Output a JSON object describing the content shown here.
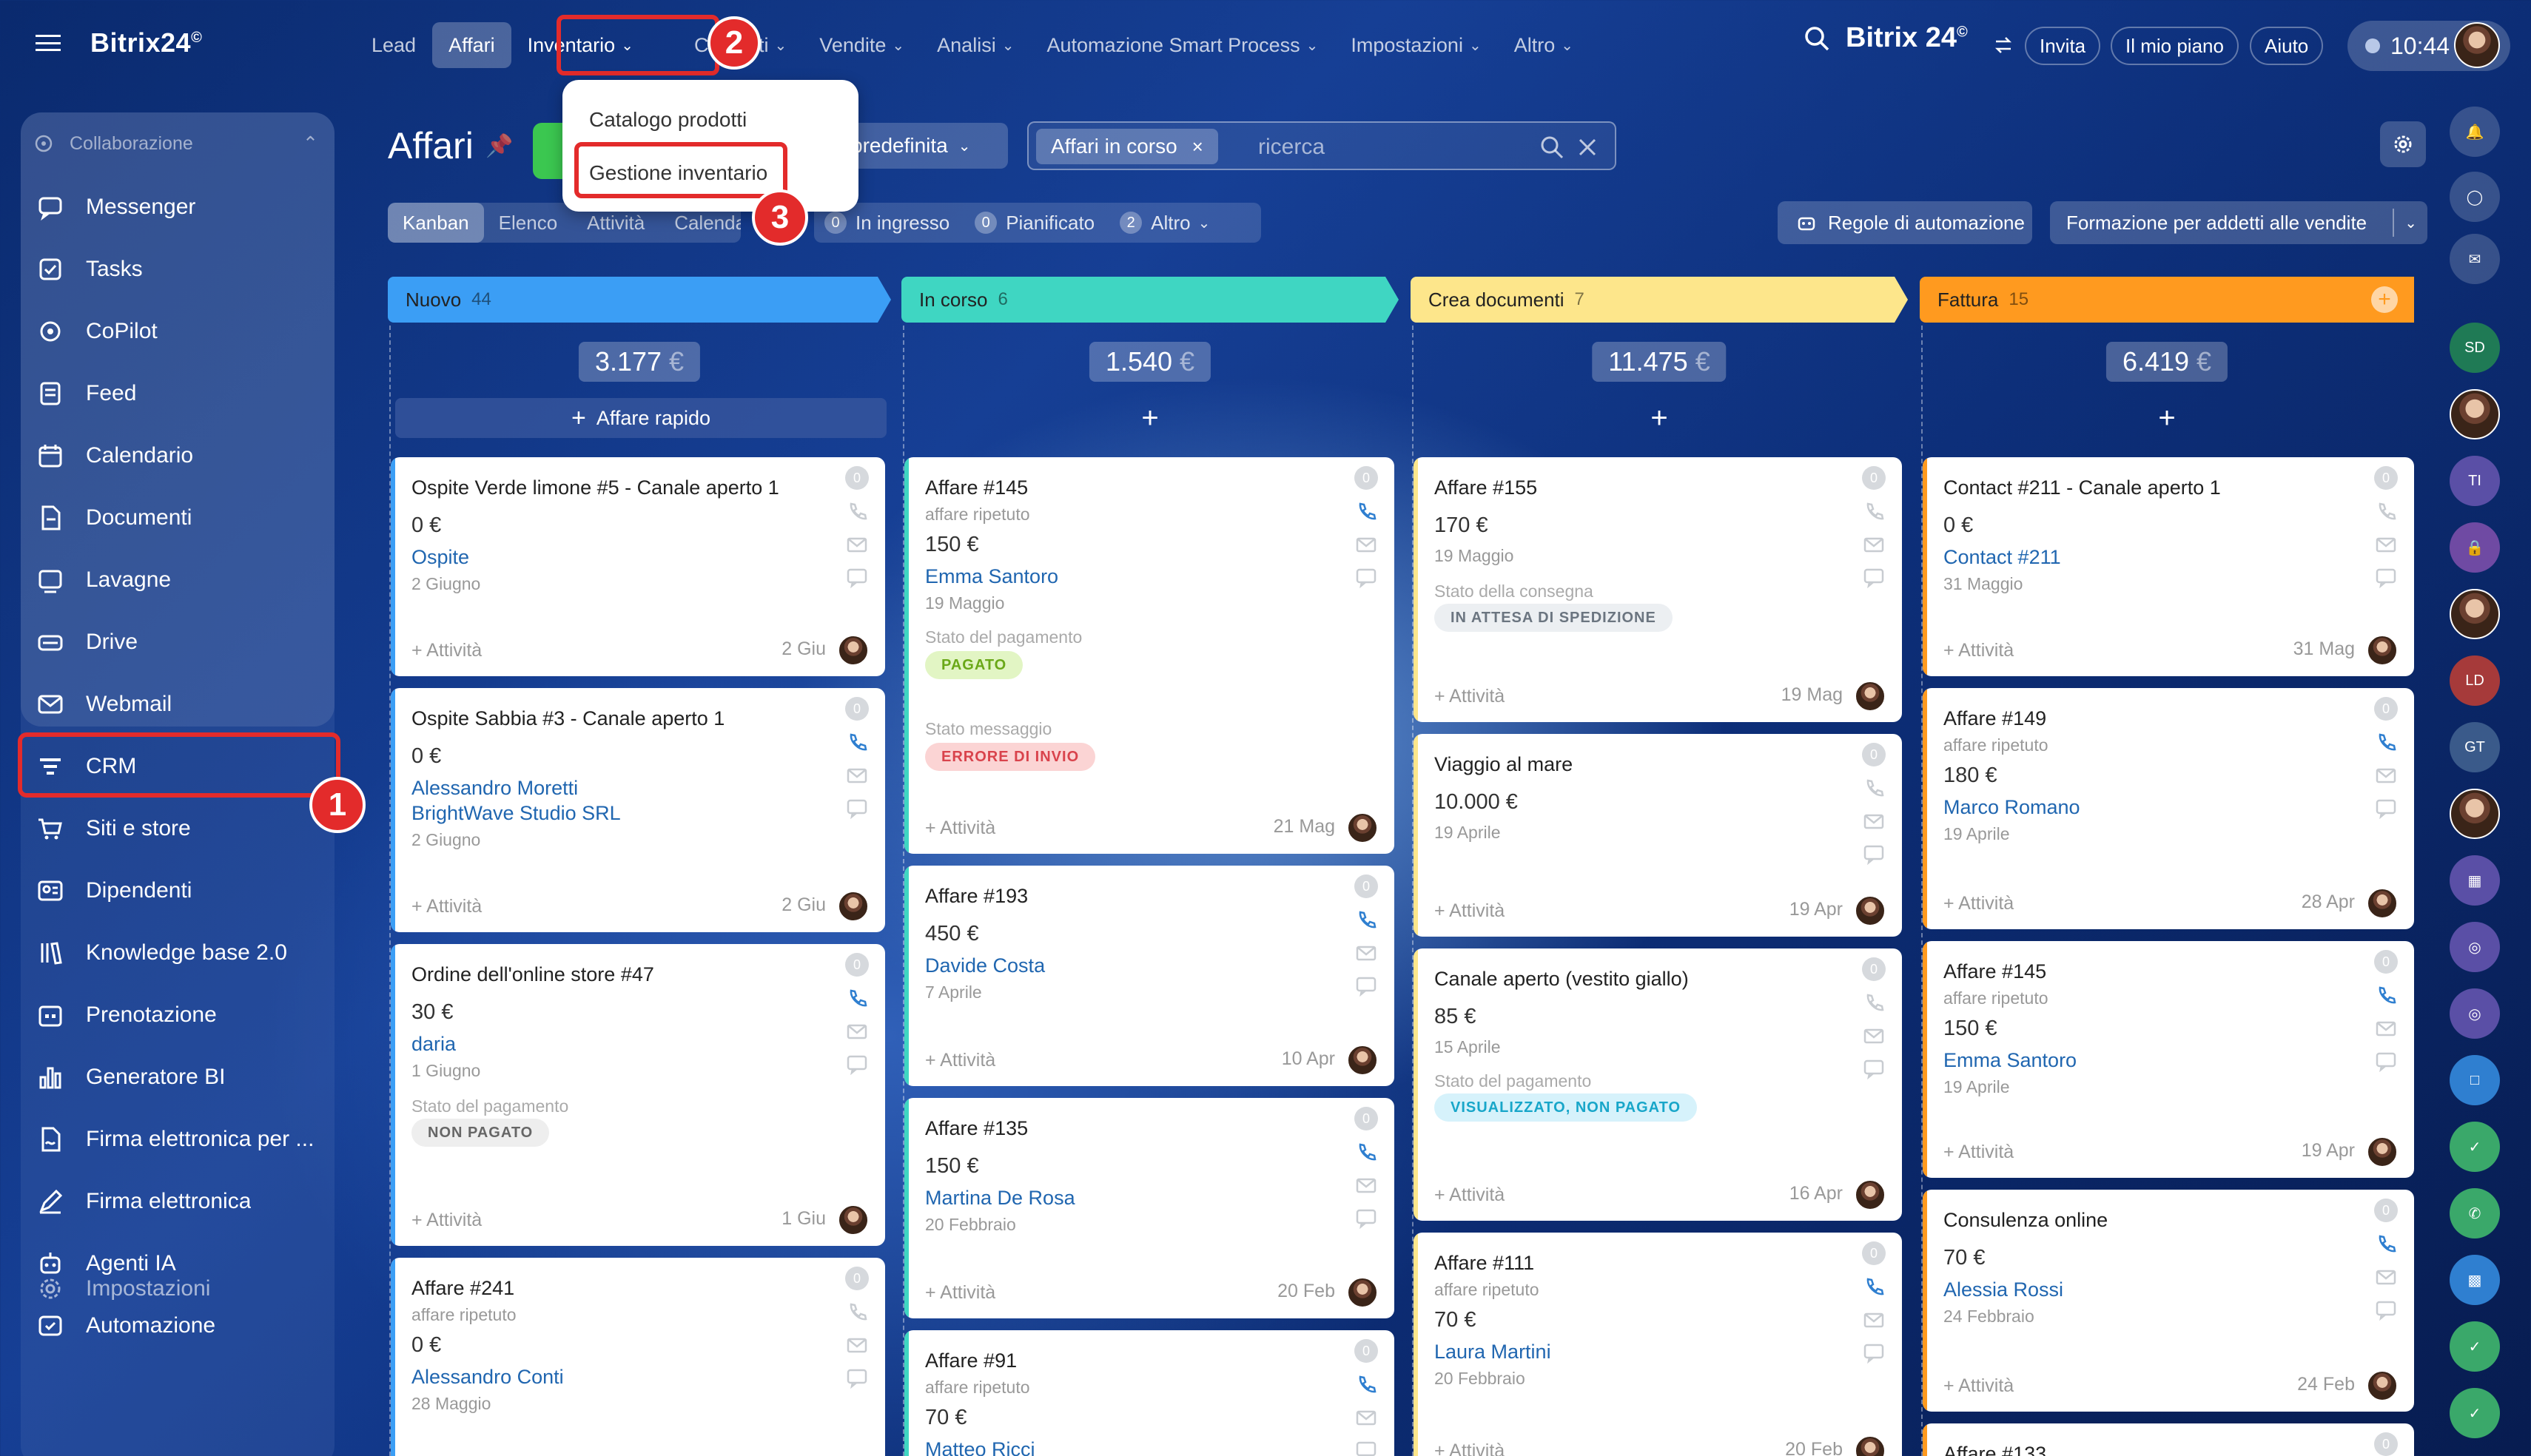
{
  "app": {
    "logo": "Bitrix24",
    "logo_mark": "©"
  },
  "sidebar": {
    "section_title": "Collaborazione",
    "items": [
      {
        "label": "Messenger",
        "icon": "chat-icon"
      },
      {
        "label": "Tasks",
        "icon": "checkbox-icon"
      },
      {
        "label": "CoPilot",
        "icon": "copilot-icon"
      },
      {
        "label": "Feed",
        "icon": "feed-icon"
      },
      {
        "label": "Calendario",
        "icon": "calendar-icon"
      },
      {
        "label": "Documenti",
        "icon": "document-icon"
      },
      {
        "label": "Lavagne",
        "icon": "board-icon"
      },
      {
        "label": "Drive",
        "icon": "drive-icon"
      },
      {
        "label": "Webmail",
        "icon": "mail-icon"
      },
      {
        "label": "CRM",
        "icon": "crm-funnel-icon"
      },
      {
        "label": "Siti e store",
        "icon": "cart-icon"
      },
      {
        "label": "Dipendenti",
        "icon": "employees-icon"
      },
      {
        "label": "Knowledge base 2.0",
        "icon": "books-icon"
      },
      {
        "label": "Prenotazione",
        "icon": "booking-icon"
      },
      {
        "label": "Generatore BI",
        "icon": "bar-chart-icon"
      },
      {
        "label": "Firma elettronica per ...",
        "icon": "signature-icon"
      },
      {
        "label": "Firma elettronica",
        "icon": "pen-icon"
      },
      {
        "label": "Agenti IA",
        "icon": "ai-agent-icon"
      },
      {
        "label": "Automazione",
        "icon": "automation-icon"
      }
    ],
    "settings": "Impostazioni"
  },
  "topnav": {
    "items": [
      "Lead",
      "Affari",
      "Inventario",
      "Contenti",
      "Vendite",
      "Analisi",
      "Automazione Smart Process",
      "Impostazioni",
      "Altro"
    ],
    "brand": "Bitrix 24",
    "invite": "Invita",
    "plan": "Il mio piano",
    "help": "Aiuto",
    "time": "10:44"
  },
  "dropdown": {
    "items": [
      "Catalogo prodotti",
      "Gestione inventario"
    ]
  },
  "badges": [
    "1",
    "2",
    "3"
  ],
  "header": {
    "title": "Affari",
    "filter_label": "predefinita",
    "search_chip": "Affari in corso",
    "search_placeholder": "ricerca",
    "views": [
      "Kanban",
      "Elenco",
      "Attività",
      "Calendario"
    ],
    "counters": [
      {
        "n": "0",
        "label": "In ingresso"
      },
      {
        "n": "0",
        "label": "Pianificato"
      },
      {
        "n": "2",
        "label": "Altro"
      }
    ],
    "rules_button": "Regole di automazione",
    "training_button": "Formazione per addetti alle vendite"
  },
  "quick_deal": "Affare rapido",
  "activity": "+ Attività",
  "columns": [
    {
      "title": "Nuovo",
      "count": "44",
      "sum": "3.177",
      "currency": "€",
      "color": "#3b9ef5"
    },
    {
      "title": "In corso",
      "count": "6",
      "sum": "1.540",
      "currency": "€",
      "color": "#3fd6c2"
    },
    {
      "title": "Crea documenti",
      "count": "7",
      "sum": "11.475",
      "currency": "€",
      "color": "#fde68b"
    },
    {
      "title": "Fattura",
      "count": "15",
      "sum": "6.419",
      "currency": "€",
      "color": "#ff9a1f"
    }
  ],
  "cards": {
    "c1": {
      "title": "Ospite Verde limone #5 - Canale aperto 1",
      "amount": "0 €",
      "link": "Ospite",
      "date": "2 Giugno",
      "deadline": "2 Giu"
    },
    "c2": {
      "title": "Ospite Sabbia #3 - Canale aperto 1",
      "amount": "0 €",
      "link": "Alessandro Moretti",
      "link2": "BrightWave Studio SRL",
      "date": "2 Giugno",
      "deadline": "2 Giu"
    },
    "c3": {
      "title": "Ordine dell'online store #47",
      "amount": "30 €",
      "link": "daria",
      "date": "1 Giugno",
      "label": "Stato del pagamento",
      "pill": "NON PAGATO",
      "deadline": "1 Giu"
    },
    "c4": {
      "title": "Affare #241",
      "sub": "affare ripetuto",
      "amount": "0 €",
      "link": "Alessandro Conti",
      "date": "28 Maggio"
    },
    "c5": {
      "title": "Affare #145",
      "sub": "affare ripetuto",
      "amount": "150 €",
      "link": "Emma Santoro",
      "date": "19 Maggio",
      "label": "Stato del pagamento",
      "pill": "PAGATO",
      "label2": "Stato messaggio",
      "pill2": "ERRORE DI INVIO",
      "deadline": "21 Mag"
    },
    "c6": {
      "title": "Affare #193",
      "amount": "450 €",
      "link": "Davide Costa",
      "date": "7 Aprile",
      "deadline": "10 Apr"
    },
    "c7": {
      "title": "Affare #135",
      "amount": "150 €",
      "link": "Martina De Rosa",
      "date": "20 Febbraio",
      "deadline": "20 Feb"
    },
    "c8": {
      "title": "Affare #91",
      "sub": "affare ripetuto",
      "amount": "70 €",
      "link": "Matteo Ricci"
    },
    "c9": {
      "title": "Affare #155",
      "amount": "170 €",
      "date": "19 Maggio",
      "label": "Stato della consegna",
      "pill": "IN ATTESA DI SPEDIZIONE",
      "deadline": "19 Mag"
    },
    "c10": {
      "title": "Viaggio al mare",
      "amount": "10.000 €",
      "date": "19 Aprile",
      "deadline": "19 Apr"
    },
    "c11": {
      "title": "Canale aperto (vestito giallo)",
      "amount": "85 €",
      "date": "15 Aprile",
      "label": "Stato del pagamento",
      "pill": "VISUALIZZATO, NON PAGATO",
      "deadline": "16 Apr"
    },
    "c12": {
      "title": "Affare #111",
      "sub": "affare ripetuto",
      "amount": "70 €",
      "link": "Laura Martini",
      "date": "20 Febbraio",
      "deadline": "20 Feb"
    },
    "c13": {
      "title": "Contact #211 - Canale aperto 1",
      "amount": "0 €",
      "link": "Contact #211",
      "date": "31 Maggio",
      "deadline": "31 Mag"
    },
    "c14": {
      "title": "Affare #149",
      "sub": "affare ripetuto",
      "amount": "180 €",
      "link": "Marco Romano",
      "date": "19 Aprile",
      "deadline": "28 Apr"
    },
    "c15": {
      "title": "Affare #145",
      "sub": "affare ripetuto",
      "amount": "150 €",
      "link": "Emma Santoro",
      "date": "19 Aprile",
      "deadline": "19 Apr"
    },
    "c16": {
      "title": "Consulenza online",
      "amount": "70 €",
      "link": "Alessia Rossi",
      "date": "24 Febbraio",
      "deadline": "24 Feb"
    },
    "c17": {
      "title": "Affare #133"
    }
  },
  "card_counter": "0",
  "right_bar": {
    "initials": [
      "SD",
      "TI",
      "LD",
      "GT"
    ]
  }
}
